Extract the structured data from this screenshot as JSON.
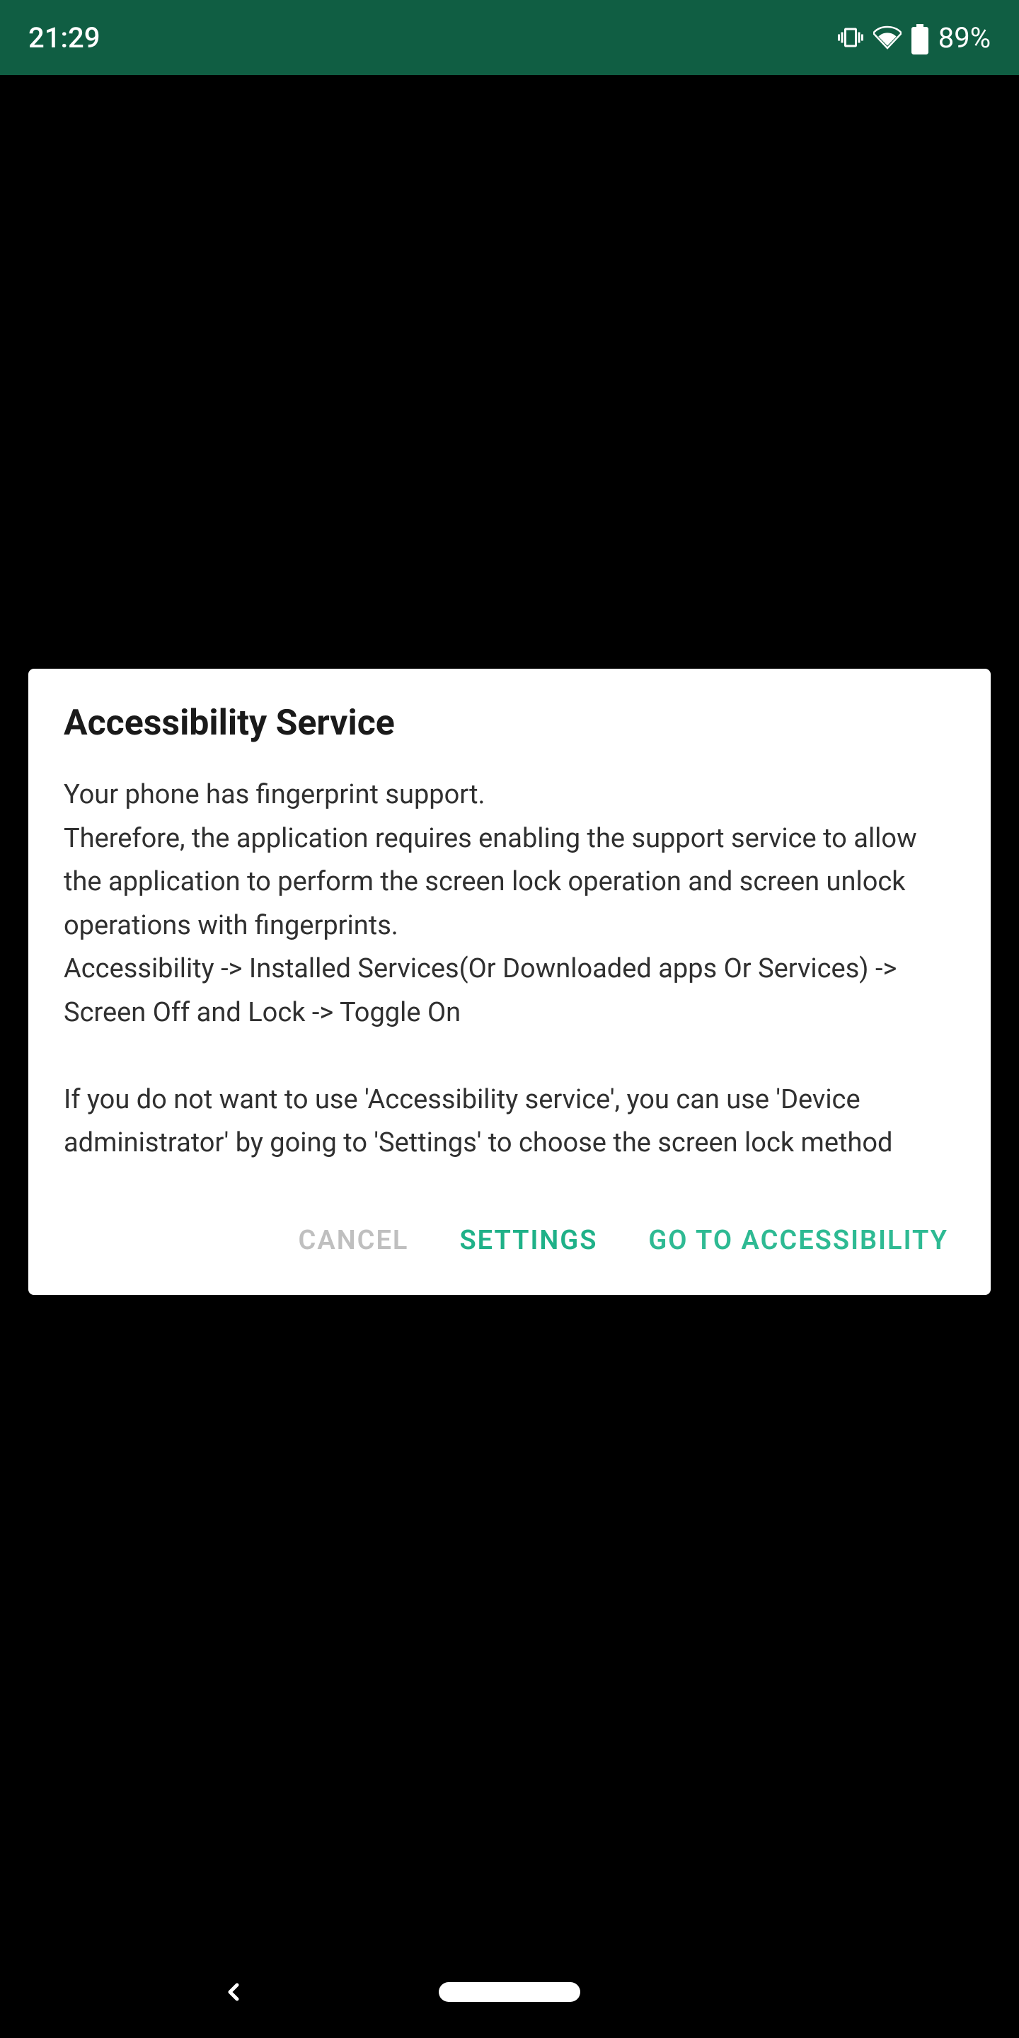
{
  "statusbar": {
    "time": "21:29",
    "battery": "89%"
  },
  "dialog": {
    "title": "Accessibility Service",
    "body": "Your phone has fingerprint support.\nTherefore, the application requires enabling the support service to allow the application to perform the screen lock operation and screen unlock operations with fingerprints.\nAccessibility -> Installed Services(Or Downloaded apps Or Services) -> Screen Off and Lock -> Toggle On\n\nIf you do not want to use 'Accessibility service', you can use 'Device administrator' by going to 'Settings' to choose the screen lock method",
    "cancel": "CANCEL",
    "settings": "SETTINGS",
    "goto": "GO TO ACCESSIBILITY"
  }
}
